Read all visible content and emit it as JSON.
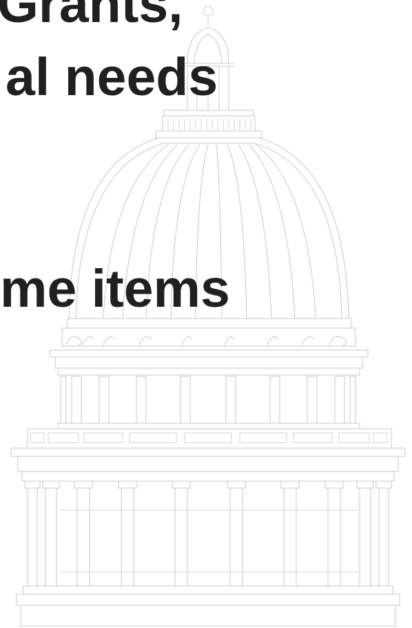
{
  "slide": {
    "lines": [
      "Grants,",
      "al needs",
      "me items"
    ]
  },
  "colors": {
    "text": "#202020",
    "background": "#ffffff",
    "illustration_stroke": "#c8c8c8"
  },
  "illustration": {
    "icon": "capitol-dome-icon"
  }
}
